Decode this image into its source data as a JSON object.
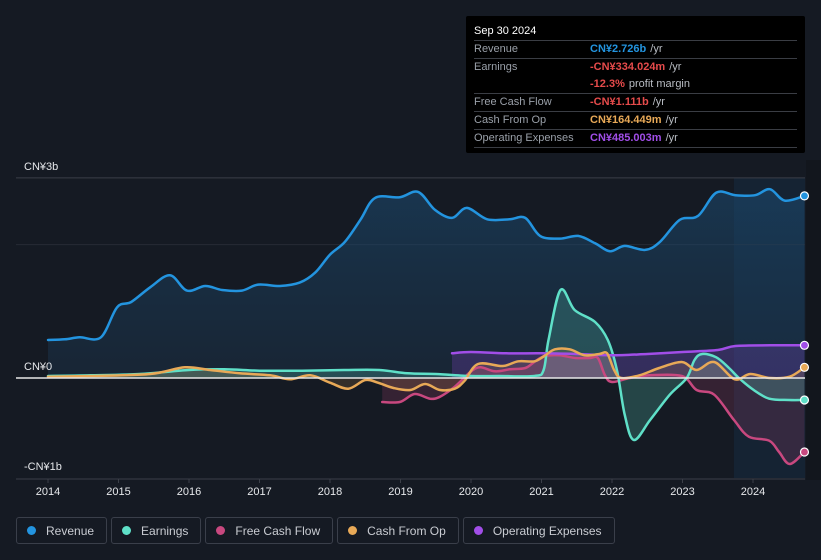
{
  "tooltip": {
    "date": "Sep 30 2024",
    "rows": [
      {
        "label": "Revenue",
        "value": "CN¥2.726b",
        "unit": "/yr",
        "color": "#2394df"
      },
      {
        "label": "Earnings",
        "value": "-CN¥334.024m",
        "unit": "/yr",
        "color": "#e64b4b"
      },
      {
        "label": "",
        "value": "-12.3%",
        "unit": "profit margin",
        "color": "#e64b4b"
      },
      {
        "label": "Free Cash Flow",
        "value": "-CN¥1.111b",
        "unit": "/yr",
        "color": "#e64b4b"
      },
      {
        "label": "Cash From Op",
        "value": "CN¥164.449m",
        "unit": "/yr",
        "color": "#e8a957"
      },
      {
        "label": "Operating Expenses",
        "value": "CN¥485.003m",
        "unit": "/yr",
        "color": "#a14ee8"
      }
    ]
  },
  "legend": [
    {
      "label": "Revenue",
      "color": "#2394df"
    },
    {
      "label": "Earnings",
      "color": "#5fe0c8"
    },
    {
      "label": "Free Cash Flow",
      "color": "#c8487f"
    },
    {
      "label": "Cash From Op",
      "color": "#e8a957"
    },
    {
      "label": "Operating Expenses",
      "color": "#a14ee8"
    }
  ],
  "chart_data": {
    "type": "line",
    "title": "",
    "xlabel": "",
    "ylabel": "",
    "units": "CN¥ billions",
    "xlim": [
      2014,
      2024.75
    ],
    "ylim": [
      -1.5,
      3.0
    ],
    "x_ticks": [
      "2014",
      "2015",
      "2016",
      "2017",
      "2018",
      "2019",
      "2020",
      "2021",
      "2022",
      "2023",
      "2024"
    ],
    "y_ticks": [
      {
        "value": 3,
        "label": "CN¥3b"
      },
      {
        "value": 0,
        "label": "CN¥0"
      },
      {
        "value": -1,
        "label": "-CN¥1b"
      }
    ],
    "gridlines": [
      3,
      2
    ],
    "highlight_from": 2023.73,
    "legend_position": "bottom",
    "series": [
      {
        "name": "Revenue",
        "color": "#2394df",
        "points": [
          [
            2014.0,
            0.57
          ],
          [
            2014.24,
            0.58
          ],
          [
            2014.45,
            0.61
          ],
          [
            2014.75,
            0.61
          ],
          [
            2014.98,
            1.06
          ],
          [
            2015.18,
            1.14
          ],
          [
            2015.45,
            1.36
          ],
          [
            2015.73,
            1.54
          ],
          [
            2015.97,
            1.31
          ],
          [
            2016.23,
            1.38
          ],
          [
            2016.47,
            1.32
          ],
          [
            2016.75,
            1.31
          ],
          [
            2016.98,
            1.4
          ],
          [
            2017.29,
            1.38
          ],
          [
            2017.57,
            1.43
          ],
          [
            2017.79,
            1.58
          ],
          [
            2018.0,
            1.85
          ],
          [
            2018.21,
            2.04
          ],
          [
            2018.43,
            2.37
          ],
          [
            2018.64,
            2.7
          ],
          [
            2018.99,
            2.71
          ],
          [
            2019.25,
            2.79
          ],
          [
            2019.49,
            2.52
          ],
          [
            2019.73,
            2.4
          ],
          [
            2019.94,
            2.55
          ],
          [
            2020.23,
            2.38
          ],
          [
            2020.55,
            2.38
          ],
          [
            2020.77,
            2.4
          ],
          [
            2020.98,
            2.13
          ],
          [
            2021.26,
            2.09
          ],
          [
            2021.52,
            2.13
          ],
          [
            2021.76,
            2.02
          ],
          [
            2021.97,
            1.9
          ],
          [
            2022.18,
            1.98
          ],
          [
            2022.47,
            1.92
          ],
          [
            2022.68,
            2.04
          ],
          [
            2022.96,
            2.37
          ],
          [
            2023.22,
            2.43
          ],
          [
            2023.48,
            2.78
          ],
          [
            2023.75,
            2.74
          ],
          [
            2024.03,
            2.74
          ],
          [
            2024.24,
            2.83
          ],
          [
            2024.45,
            2.66
          ],
          [
            2024.73,
            2.73
          ]
        ]
      },
      {
        "name": "Earnings",
        "color": "#5fe0c8",
        "points": [
          [
            2014.0,
            0.03
          ],
          [
            2014.6,
            0.04
          ],
          [
            2015.3,
            0.06
          ],
          [
            2016.0,
            0.12
          ],
          [
            2016.5,
            0.13
          ],
          [
            2017.0,
            0.11
          ],
          [
            2017.6,
            0.11
          ],
          [
            2018.2,
            0.12
          ],
          [
            2018.7,
            0.12
          ],
          [
            2019.1,
            0.07
          ],
          [
            2019.5,
            0.06
          ],
          [
            2020.0,
            0.03
          ],
          [
            2020.4,
            0.03
          ],
          [
            2020.9,
            0.03
          ],
          [
            2021.03,
            0.12
          ],
          [
            2021.1,
            0.57
          ],
          [
            2021.27,
            1.32
          ],
          [
            2021.47,
            1.02
          ],
          [
            2021.76,
            0.84
          ],
          [
            2021.94,
            0.57
          ],
          [
            2022.07,
            0.12
          ],
          [
            2022.18,
            -0.55
          ],
          [
            2022.31,
            -0.93
          ],
          [
            2022.54,
            -0.63
          ],
          [
            2022.82,
            -0.25
          ],
          [
            2023.06,
            0.0
          ],
          [
            2023.17,
            0.27
          ],
          [
            2023.28,
            0.36
          ],
          [
            2023.48,
            0.31
          ],
          [
            2023.66,
            0.15
          ],
          [
            2023.8,
            0.0
          ],
          [
            2024.01,
            -0.18
          ],
          [
            2024.23,
            -0.31
          ],
          [
            2024.51,
            -0.33
          ],
          [
            2024.73,
            -0.33
          ]
        ]
      },
      {
        "name": "Free Cash Flow",
        "color": "#c8487f",
        "points": [
          [
            2018.74,
            -0.36
          ],
          [
            2018.99,
            -0.36
          ],
          [
            2019.2,
            -0.24
          ],
          [
            2019.42,
            -0.31
          ],
          [
            2019.56,
            -0.28
          ],
          [
            2019.77,
            -0.13
          ],
          [
            2019.99,
            0.09
          ],
          [
            2020.13,
            0.16
          ],
          [
            2020.34,
            0.1
          ],
          [
            2020.55,
            0.13
          ],
          [
            2020.77,
            0.15
          ],
          [
            2020.91,
            0.25
          ],
          [
            2021.05,
            0.33
          ],
          [
            2021.26,
            0.34
          ],
          [
            2021.48,
            0.3
          ],
          [
            2021.69,
            0.3
          ],
          [
            2021.8,
            0.3
          ],
          [
            2021.9,
            0.04
          ],
          [
            2022.0,
            -0.06
          ],
          [
            2022.25,
            -0.0
          ],
          [
            2022.53,
            0.04
          ],
          [
            2022.99,
            0.03
          ],
          [
            2023.2,
            -0.18
          ],
          [
            2023.45,
            -0.25
          ],
          [
            2023.73,
            -0.63
          ],
          [
            2023.94,
            -0.88
          ],
          [
            2024.23,
            -0.94
          ],
          [
            2024.37,
            -1.11
          ],
          [
            2024.52,
            -1.29
          ],
          [
            2024.73,
            -1.11
          ]
        ]
      },
      {
        "name": "Cash From Op",
        "color": "#e8a957",
        "points": [
          [
            2014.0,
            0.02
          ],
          [
            2014.6,
            0.03
          ],
          [
            2015.45,
            0.06
          ],
          [
            2015.94,
            0.16
          ],
          [
            2016.3,
            0.12
          ],
          [
            2016.72,
            0.07
          ],
          [
            2017.15,
            0.04
          ],
          [
            2017.43,
            -0.02
          ],
          [
            2017.72,
            0.04
          ],
          [
            2018.0,
            -0.07
          ],
          [
            2018.26,
            -0.16
          ],
          [
            2018.5,
            -0.03
          ],
          [
            2018.68,
            -0.07
          ],
          [
            2018.9,
            -0.15
          ],
          [
            2019.14,
            -0.18
          ],
          [
            2019.35,
            -0.09
          ],
          [
            2019.56,
            -0.18
          ],
          [
            2019.77,
            -0.16
          ],
          [
            2019.91,
            -0.04
          ],
          [
            2020.1,
            0.21
          ],
          [
            2020.45,
            0.18
          ],
          [
            2020.67,
            0.25
          ],
          [
            2020.9,
            0.25
          ],
          [
            2021.04,
            0.33
          ],
          [
            2021.19,
            0.43
          ],
          [
            2021.4,
            0.43
          ],
          [
            2021.61,
            0.34
          ],
          [
            2021.82,
            0.36
          ],
          [
            2021.93,
            0.37
          ],
          [
            2022.03,
            0.12
          ],
          [
            2022.13,
            0.0
          ],
          [
            2022.39,
            0.04
          ],
          [
            2022.67,
            0.15
          ],
          [
            2022.99,
            0.24
          ],
          [
            2023.2,
            0.12
          ],
          [
            2023.45,
            0.24
          ],
          [
            2023.74,
            -0.02
          ],
          [
            2023.96,
            0.06
          ],
          [
            2024.24,
            0.0
          ],
          [
            2024.52,
            0.02
          ],
          [
            2024.73,
            0.16
          ]
        ]
      },
      {
        "name": "Operating Expenses",
        "color": "#a14ee8",
        "points": [
          [
            2019.73,
            0.37
          ],
          [
            2020.0,
            0.39
          ],
          [
            2020.5,
            0.37
          ],
          [
            2021.0,
            0.37
          ],
          [
            2021.5,
            0.36
          ],
          [
            2022.0,
            0.34
          ],
          [
            2022.5,
            0.36
          ],
          [
            2023.0,
            0.39
          ],
          [
            2023.5,
            0.42
          ],
          [
            2023.75,
            0.48
          ],
          [
            2024.25,
            0.49
          ],
          [
            2024.73,
            0.49
          ]
        ]
      }
    ]
  }
}
